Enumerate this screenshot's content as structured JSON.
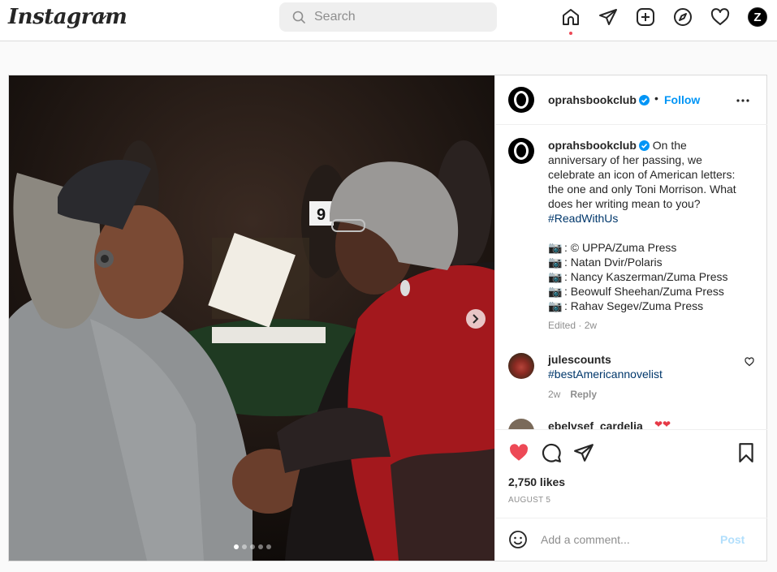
{
  "nav": {
    "logo": "Instagram",
    "search_placeholder": "Search",
    "avatar_letter": "Z",
    "icons": [
      "home-icon",
      "direct-icon",
      "new-post-icon",
      "explore-icon",
      "activity-icon"
    ]
  },
  "post": {
    "username": "oprahsbookclub",
    "bullet": "•",
    "follow": "Follow",
    "caption_text": "On the anniversary of her passing, we celebrate an icon of American letters: the one and only Toni Morrison. What does her writing mean to you? ",
    "caption_hashtag": "#ReadWithUs",
    "credits": [
      ": © UPPA/Zuma Press",
      ": Natan Dvir/Polaris",
      ": Nancy Kaszerman/Zuma Press",
      ": Beowulf Sheehan/Zuma Press",
      ": Rahav Segev/Zuma Press"
    ],
    "edited": "Edited · 2w",
    "likes": "2,750 likes",
    "date": "AUGUST 5",
    "photo_dots": 5
  },
  "comments": [
    {
      "username": "julescounts",
      "text": "#bestAmericannovelist",
      "time": "2w",
      "reply": "Reply"
    },
    {
      "username": "ebelvsef_cardelia",
      "emoji": "❤❤"
    }
  ],
  "composer": {
    "placeholder": "Add a comment...",
    "post_label": "Post"
  },
  "colors": {
    "accent": "#0095f6",
    "like_red": "#ed4956",
    "hashtag": "#00376b",
    "muted": "#8e8e8e"
  }
}
